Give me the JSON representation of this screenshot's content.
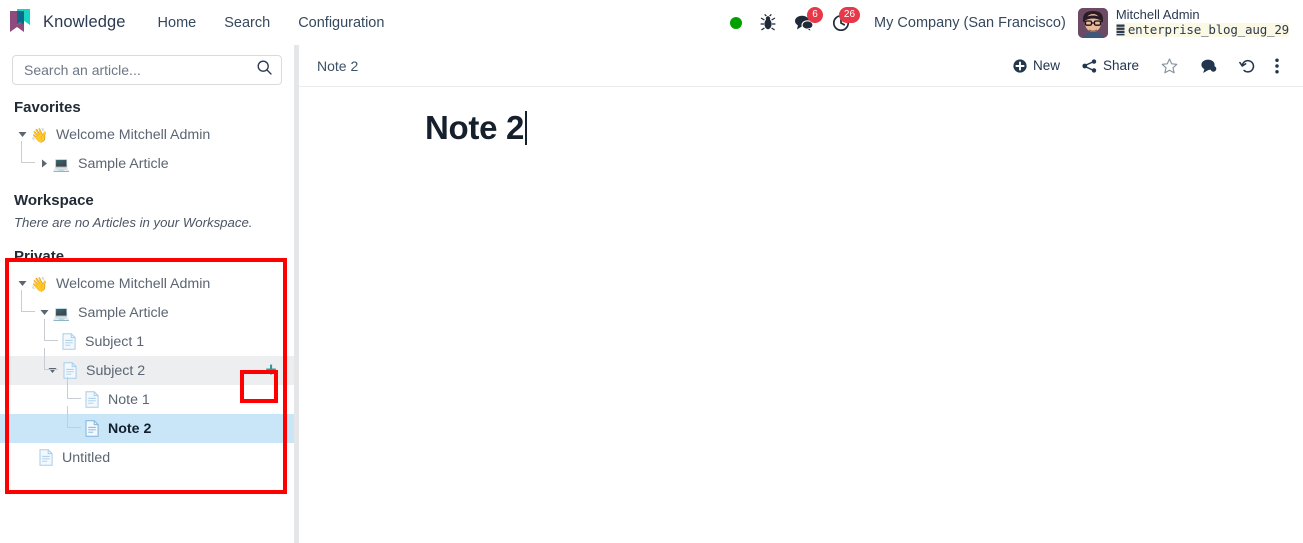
{
  "navbar": {
    "brand": "Knowledge",
    "menu": [
      {
        "label": "Home"
      },
      {
        "label": "Search"
      },
      {
        "label": "Configuration"
      }
    ],
    "status_dot": "online-status-dot",
    "debug_icon": "bug-icon",
    "messages": {
      "icon": "chat-bubble-icon",
      "count": "6"
    },
    "activities": {
      "icon": "clock-icon",
      "count": "26"
    },
    "company": "My Company (San Francisco)",
    "user": {
      "name": "Mitchell Admin",
      "database": "enterprise_blog_aug_29",
      "db_icon": "database-icon",
      "avatar": "user-avatar"
    }
  },
  "sidebar": {
    "search": {
      "placeholder": "Search an article...",
      "value": "",
      "icon": "search-icon"
    },
    "favorites": {
      "title": "Favorites",
      "items": [
        {
          "label": "Welcome Mitchell Admin",
          "icon": "waving-hand-emoji",
          "caret": "down",
          "depth": 0
        },
        {
          "label": "Sample Article",
          "icon": "laptop-emoji",
          "caret": "right",
          "depth": 1
        }
      ]
    },
    "workspace": {
      "title": "Workspace",
      "empty_text": "There are no Articles in your Workspace."
    },
    "private": {
      "title": "Private",
      "items": [
        {
          "label": "Welcome Mitchell Admin",
          "icon": "waving-hand-emoji",
          "caret": "down",
          "depth": 0,
          "state": ""
        },
        {
          "label": "Sample Article",
          "icon": "laptop-emoji",
          "caret": "down",
          "depth": 1,
          "state": ""
        },
        {
          "label": "Subject 1",
          "icon": "document-icon",
          "caret": "none",
          "depth": 2,
          "state": ""
        },
        {
          "label": "Subject 2",
          "icon": "document-icon",
          "caret": "down",
          "depth": 2,
          "state": "hovered",
          "add_button": "+"
        },
        {
          "label": "Note 1",
          "icon": "document-icon",
          "caret": "none",
          "depth": 3,
          "state": ""
        },
        {
          "label": "Note 2",
          "icon": "document-icon",
          "caret": "none",
          "depth": 3,
          "state": "selected"
        },
        {
          "label": "Untitled",
          "icon": "document-icon",
          "caret": "none",
          "depth": 0,
          "state": ""
        }
      ]
    }
  },
  "main": {
    "breadcrumb": "Note 2",
    "actions": [
      {
        "label": "New",
        "icon": "plus-circle-icon"
      },
      {
        "label": "Share",
        "icon": "share-icon"
      },
      {
        "label": "",
        "icon": "star-icon"
      },
      {
        "label": "",
        "icon": "comment-icon"
      },
      {
        "label": "",
        "icon": "history-icon"
      },
      {
        "label": "",
        "icon": "vertical-dots-icon"
      }
    ],
    "document": {
      "title": "Note 2"
    }
  },
  "colors": {
    "accent_teal": "#2a9d9a",
    "annotation_red": "#ff0000",
    "selected_row": "#c8e6f7",
    "badge_red": "#e7384a",
    "status_green": "#00a000"
  }
}
